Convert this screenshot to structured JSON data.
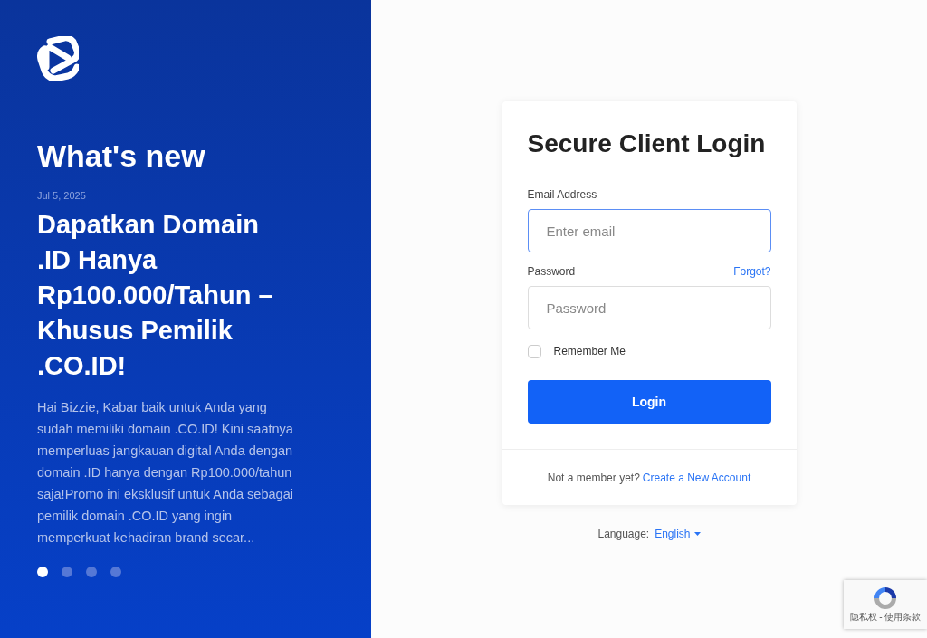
{
  "news": {
    "heading": "What's new",
    "date": "Jul 5, 2025",
    "title": "Dapatkan Domain .ID Hanya Rp100.000/Tahun – Khusus Pemilik .CO.ID!",
    "body": "Hai Bizzie, Kabar baik untuk Anda yang sudah memiliki domain .CO.ID! Kini saatnya memperluas jangkauan digital Anda dengan domain .ID hanya dengan Rp100.000/tahun saja!Promo ini eksklusif untuk Anda sebagai pemilik domain .CO.ID yang ingin memperkuat kehadiran brand secar...",
    "dots": [
      {
        "selected": true
      },
      {
        "selected": false
      },
      {
        "selected": false
      },
      {
        "selected": false
      }
    ]
  },
  "login": {
    "title": "Secure Client Login",
    "email_label": "Email Address",
    "email_placeholder": "Enter email",
    "password_label": "Password",
    "forgot": "Forgot?",
    "password_placeholder": "Password",
    "remember": {
      "label": "Remember Me",
      "checked": false
    },
    "button": "Login",
    "signup_prompt": "Not a member yet?",
    "signup_link": "Create a New Account"
  },
  "language": {
    "label": "Language:",
    "value": "English"
  },
  "recaptcha": {
    "links": "隐私权 - 使用条款"
  }
}
